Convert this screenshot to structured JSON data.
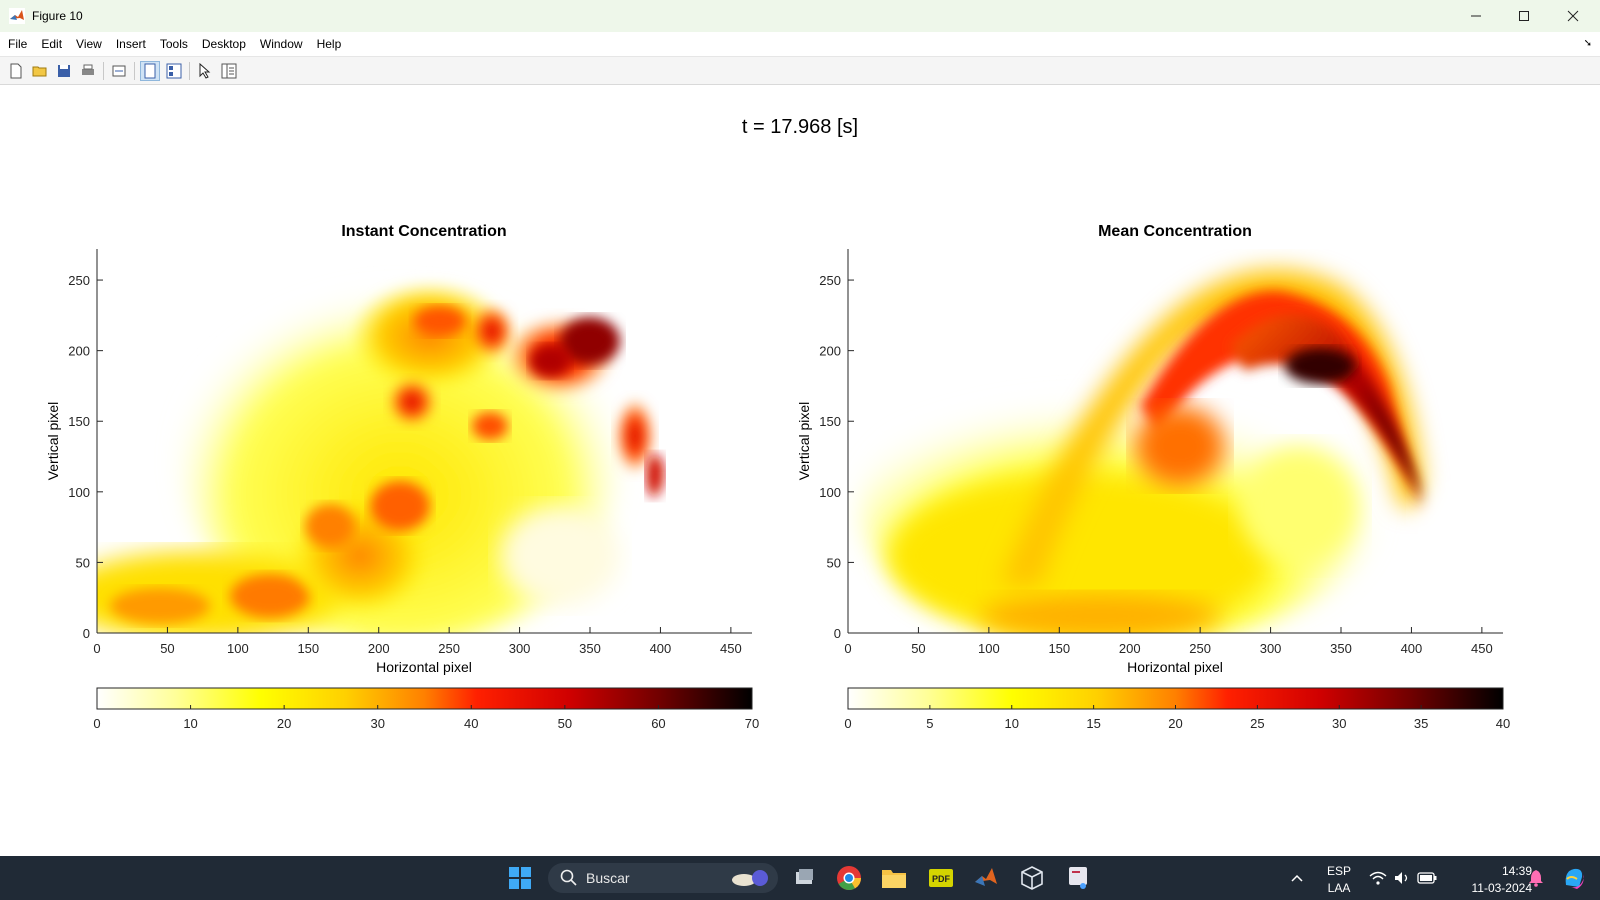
{
  "window": {
    "title": "Figure 10"
  },
  "menu": [
    "File",
    "Edit",
    "View",
    "Insert",
    "Tools",
    "Desktop",
    "Window",
    "Help"
  ],
  "figure": {
    "super_title": "t = 17.968 [s]",
    "left_plot": {
      "title": "Instant Concentration",
      "xlabel": "Horizontal pixel",
      "ylabel": "Vertical pixel",
      "xticks": [
        "0",
        "50",
        "100",
        "150",
        "200",
        "250",
        "300",
        "350",
        "400",
        "450"
      ],
      "yticks": [
        "0",
        "50",
        "100",
        "150",
        "200",
        "250"
      ],
      "colorbar_ticks": [
        "0",
        "10",
        "20",
        "30",
        "40",
        "50",
        "60",
        "70"
      ]
    },
    "right_plot": {
      "title": "Mean Concentration",
      "xlabel": "Horizontal pixel",
      "ylabel": "Vertical pixel",
      "xticks": [
        "0",
        "50",
        "100",
        "150",
        "200",
        "250",
        "300",
        "350",
        "400",
        "450"
      ],
      "yticks": [
        "0",
        "50",
        "100",
        "150",
        "200",
        "250"
      ],
      "colorbar_ticks": [
        "0",
        "5",
        "10",
        "15",
        "20",
        "25",
        "30",
        "35",
        "40"
      ]
    }
  },
  "chart_data": [
    {
      "type": "heatmap",
      "title": "Instant Concentration",
      "xlabel": "Horizontal pixel",
      "ylabel": "Vertical pixel",
      "xlim": [
        0,
        465
      ],
      "ylim": [
        0,
        272
      ],
      "clim": [
        0,
        70
      ],
      "colormap": "hot (reversed: white-yellow-red-black)"
    },
    {
      "type": "heatmap",
      "title": "Mean Concentration",
      "xlabel": "Horizontal pixel",
      "ylabel": "Vertical pixel",
      "xlim": [
        0,
        465
      ],
      "ylim": [
        0,
        272
      ],
      "clim": [
        0,
        40
      ],
      "colormap": "hot (reversed: white-yellow-red-black)"
    }
  ],
  "taskbar": {
    "search_placeholder": "Buscar",
    "lang": "ESP",
    "layout": "LAA",
    "time": "14:39",
    "date": "11-03-2024"
  },
  "colors": {
    "titlebar_bg": "#eef7ea",
    "taskbar_bg": "#202a36"
  }
}
